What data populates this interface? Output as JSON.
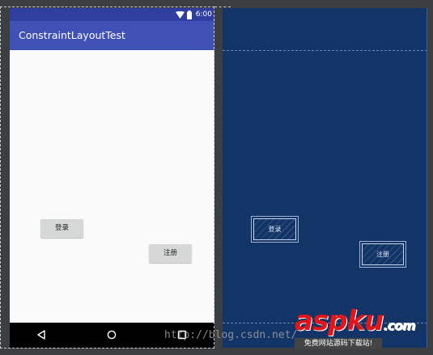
{
  "status_bar": {
    "time": "6:00"
  },
  "app_bar": {
    "title": "ConstraintLayoutTest"
  },
  "buttons": {
    "login": "登录",
    "register": "注册"
  },
  "blueprint": {
    "login": "登录",
    "register": "注册"
  },
  "watermark": {
    "url": "http://blog.csdn.net/",
    "logo": "aspku",
    "logo_dotcom": ".com",
    "logo_tagline": "免费网站源码下载站!"
  },
  "colors": {
    "status_bar": "#303f9f",
    "app_bar": "#3f51b5",
    "blueprint_bg": "#133466",
    "logo_red": "#e2151b"
  }
}
